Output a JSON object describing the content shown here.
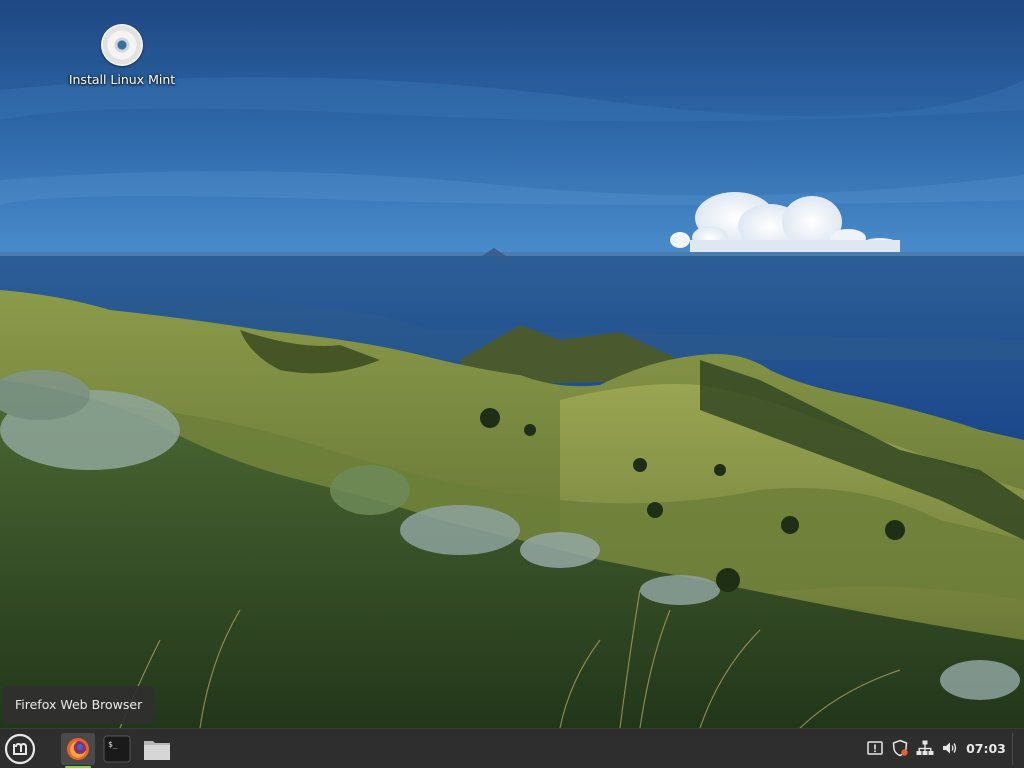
{
  "desktop": {
    "icons": [
      {
        "label": "Install Linux Mint",
        "icon": "disc-icon"
      }
    ]
  },
  "tooltip": {
    "text": "Firefox Web Browser"
  },
  "panel": {
    "launchers": [
      {
        "name": "Menu",
        "icon": "linux-mint-logo-icon"
      },
      {
        "name": "Firefox Web Browser",
        "icon": "firefox-icon",
        "active": true
      },
      {
        "name": "Terminal",
        "icon": "terminal-icon"
      },
      {
        "name": "Files",
        "icon": "folder-icon"
      }
    ],
    "tray": [
      {
        "icon": "notification-alert-icon"
      },
      {
        "icon": "update-manager-shield-icon"
      },
      {
        "icon": "network-icon"
      },
      {
        "icon": "volume-icon"
      }
    ],
    "clock": "07:03"
  },
  "colors": {
    "panel_bg": "#2e2e2e",
    "active_indicator": "#8ccf4d",
    "firefox_accent": "#e8622c"
  }
}
